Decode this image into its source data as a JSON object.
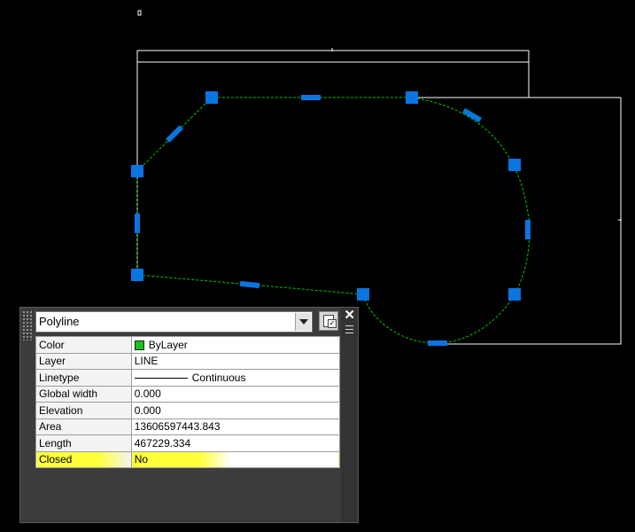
{
  "colors": {
    "grip": "#0a74e0",
    "polyline": "#00c800",
    "frame": "#ffffff",
    "highlight": "#ffff3c",
    "bylayer_swatch": "#19c419"
  },
  "palette": {
    "object_type": "Polyline",
    "properties": [
      {
        "label": "Color",
        "value": "ByLayer",
        "swatch": true
      },
      {
        "label": "Layer",
        "value": "LINE"
      },
      {
        "label": "Linetype",
        "value": "Continuous",
        "line_sample": true
      },
      {
        "label": "Global width",
        "value": "0.000"
      },
      {
        "label": "Elevation",
        "value": "0.000"
      },
      {
        "label": "Area",
        "value": "13606597443.843"
      },
      {
        "label": "Length",
        "value": "467229.334"
      },
      {
        "label": "Closed",
        "value": "No",
        "highlighted": true
      }
    ],
    "close_icon": "close-icon",
    "settings_icon": "customize-icon",
    "options_icon": "menu-icon"
  }
}
